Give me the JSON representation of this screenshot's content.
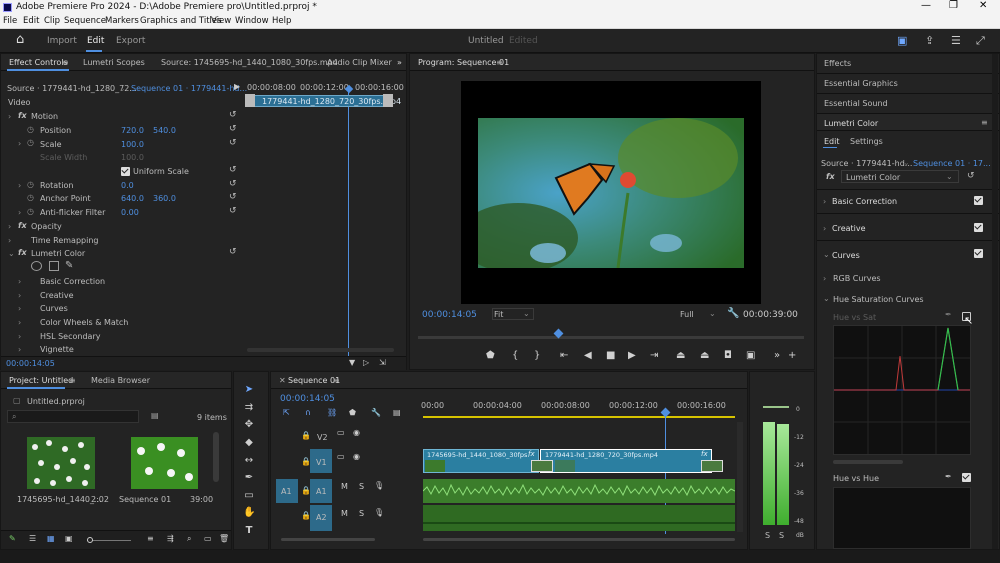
{
  "titlebar": {
    "title": "Adobe Premiere Pro 2024 - D:\\Adobe Premiere pro\\Untitled.prproj *"
  },
  "menu": [
    "File",
    "Edit",
    "Clip",
    "Sequence",
    "Markers",
    "Graphics and Titles",
    "View",
    "Window",
    "Help"
  ],
  "header": {
    "import": "Import",
    "edit": "Edit",
    "export": "Export",
    "project_name": "Untitled",
    "status": "Edited"
  },
  "effect_controls": {
    "tab": "Effect Controls",
    "tab2": "Lumetri Scopes",
    "tab3": "Source: 1745695-hd_1440_1080_30fps.mp4",
    "tab4": "Audio Clip Mixer",
    "source": "Source · 1779441-hd_1280_72...",
    "sequence": "Sequence 01 · 1779441-hd...",
    "times": [
      "00:00:08:00",
      "00:00:12:00",
      "00:00:16:00"
    ],
    "clip": "1779441-hd_1280_720_30fps.mp4",
    "section": "Video",
    "motion": "Motion",
    "position": "Position",
    "pos_x": "720.0",
    "pos_y": "540.0",
    "scale": "Scale",
    "scale_v": "100.0",
    "scale_width": "Scale Width",
    "scale_width_v": "100.0",
    "uniform": "Uniform Scale",
    "rotation": "Rotation",
    "rotation_v": "0.0",
    "anchor": "Anchor Point",
    "anchor_x": "640.0",
    "anchor_y": "360.0",
    "antiflicker": "Anti-flicker Filter",
    "antiflicker_v": "0.00",
    "opacity": "Opacity",
    "time_remap": "Time Remapping",
    "lumetri": "Lumetri Color",
    "sub": [
      "Basic Correction",
      "Creative",
      "Curves",
      "Color Wheels & Match",
      "HSL Secondary",
      "Vignette"
    ],
    "timecode": "00:00:14:05"
  },
  "program": {
    "tab": "Program: Sequence 01",
    "timecode": "00:00:14:05",
    "fit": "Fit",
    "quality": "Full",
    "duration": "00:00:39:00"
  },
  "right": {
    "effects": "Effects",
    "graphics": "Essential Graphics",
    "sound": "Essential Sound",
    "lumetri_tab": "Lumetri Color",
    "edit": "Edit",
    "settings": "Settings",
    "source": "Source · 1779441-hd...",
    "sequence": "Sequence 01 · 17...",
    "effect_name": "Lumetri Color",
    "basic": "Basic Correction",
    "creative": "Creative",
    "curves": "Curves",
    "rgb": "RGB Curves",
    "hue_sat": "Hue Saturation Curves",
    "hue_vs_sat": "Hue vs Sat",
    "hue_vs_hue": "Hue vs Hue"
  },
  "project": {
    "tab": "Project: Untitled",
    "tab2": "Media Browser",
    "file": "Untitled.prproj",
    "items": "9 items",
    "clip1": "1745695-hd_1440_...",
    "clip1_dur": "2:02",
    "clip2": "Sequence 01",
    "clip2_dur": "39:00"
  },
  "timeline": {
    "tab": "Sequence 01",
    "timecode": "00:00:14:05",
    "ruler": [
      "00:00",
      "00:00:04:00",
      "00:00:08:00",
      "00:00:12:00",
      "00:00:16:00"
    ],
    "v2": "V2",
    "v1": "V1",
    "a1": "A1",
    "a2": "A2",
    "clip_a": "1745695-hd_1440_1080_30fps.",
    "clip_b": "1779441-hd_1280_720_30fps.mp4",
    "fx": "fx"
  },
  "meter": {
    "labels": [
      "0",
      "-12",
      "-24",
      "-36",
      "-48",
      "dB"
    ],
    "s": "S"
  }
}
